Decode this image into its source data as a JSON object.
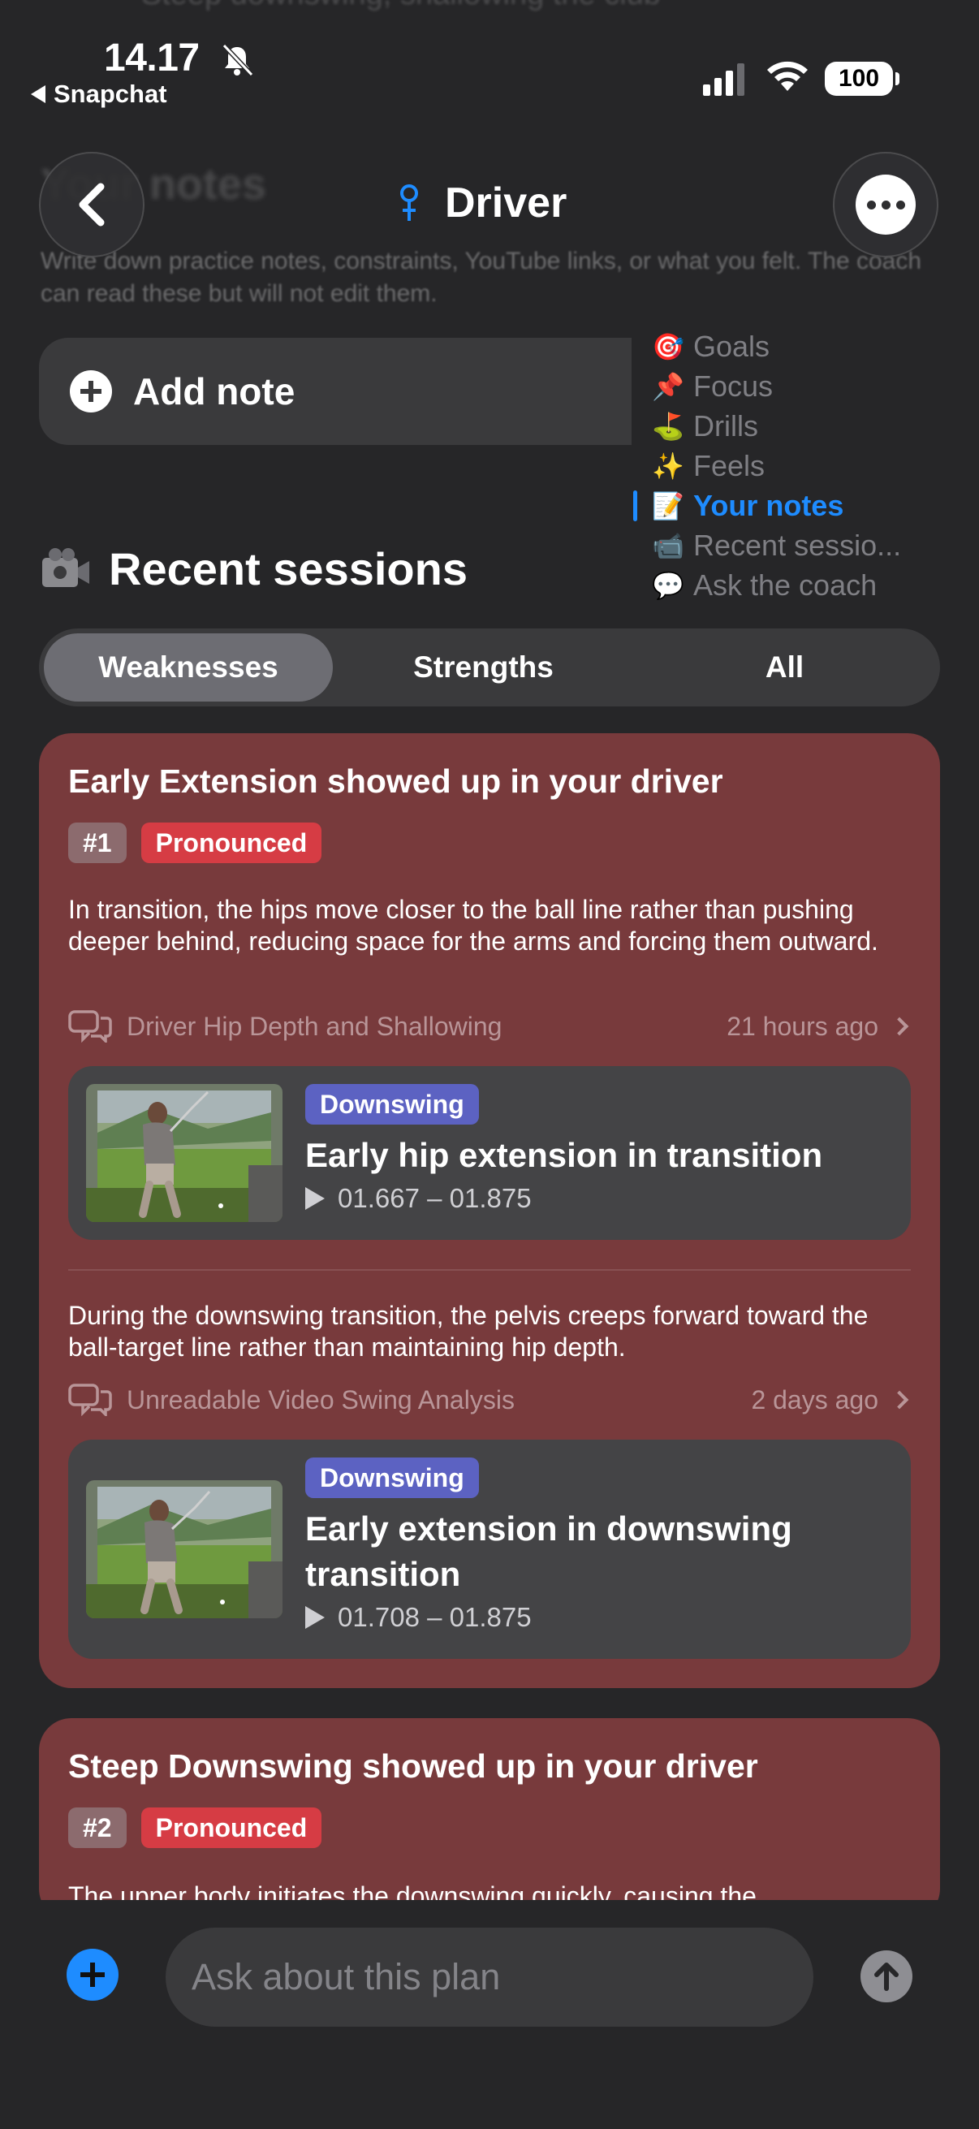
{
  "status_bar": {
    "time": "14.17",
    "back_app": "Snapchat",
    "battery": "100"
  },
  "background_text": {
    "top_line": "• Steep downswing, shallowing the club",
    "heading": "Your notes",
    "description": "Write down practice notes, constraints, YouTube links, or what you felt. The coach can read these but will not edit them."
  },
  "header": {
    "title": "Driver",
    "title_icon": "location-pin-icon"
  },
  "add_note": {
    "label": "Add note"
  },
  "toc": {
    "items": [
      {
        "emoji": "🎯",
        "label": "Goals",
        "active": false
      },
      {
        "emoji": "📌",
        "label": "Focus",
        "active": false
      },
      {
        "emoji": "⛳",
        "label": "Drills",
        "active": false
      },
      {
        "emoji": "✨",
        "label": "Feels",
        "active": false
      },
      {
        "emoji": "📝",
        "label": "Your notes",
        "active": true
      },
      {
        "emoji": "📹",
        "label": "Recent sessio...",
        "active": false
      },
      {
        "emoji": "💬",
        "label": "Ask the coach",
        "active": false
      }
    ]
  },
  "recent_sessions": {
    "title": "Recent sessions",
    "tabs": [
      "Weaknesses",
      "Strengths",
      "All"
    ],
    "active_tab": "Weaknesses"
  },
  "cards": [
    {
      "title": "Early Extension showed up in your driver",
      "rank": "#1",
      "level": "Pronounced",
      "observations": [
        {
          "text": "In transition, the hips move closer to the ball line rather than pushing deeper behind, reducing space for the arms and forcing them outward.",
          "source": "Driver Hip Depth and Shallowing",
          "ago": "21 hours ago",
          "clip": {
            "phase": "Downswing",
            "title": "Early hip extension in transition",
            "range": "01.667 – 01.875"
          }
        },
        {
          "text": "During the downswing transition, the pelvis creeps forward toward the ball-target line rather than maintaining hip depth.",
          "source": "Unreadable Video Swing Analysis",
          "ago": "2 days ago",
          "clip": {
            "phase": "Downswing",
            "title": "Early extension in downswing transition",
            "range": "01.708 – 01.875"
          }
        }
      ]
    },
    {
      "title": "Steep Downswing showed up in your driver",
      "rank": "#2",
      "level": "Pronounced",
      "text": "The upper body initiates the downswing quickly, causing the"
    }
  ],
  "composer": {
    "placeholder": "Ask about this plan"
  },
  "colors": {
    "background": "#262628",
    "card": "#783a3c",
    "accent": "#1e8cff",
    "pronounced": "#d63c44",
    "phase_tag": "#5c62c2"
  }
}
